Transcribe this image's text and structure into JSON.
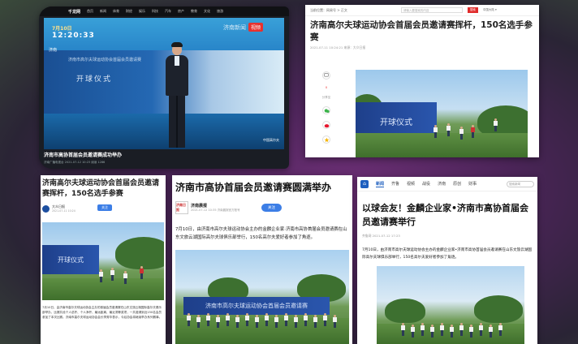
{
  "card1": {
    "topbar_brand": "千龙网",
    "topbar_items": [
      "首页",
      "新闻",
      "体育",
      "财经",
      "娱乐",
      "科技",
      "汽车",
      "房产",
      "教育",
      "文化",
      "旅游"
    ],
    "clock_date": "7月10日",
    "clock_time": "12:20:33",
    "channel": "济南",
    "watermark": "济南新闻",
    "watermark_badge": "视频",
    "backdrop_title": "开球仪式",
    "backdrop_sub": "济南市高尔夫球运动协会首届会员邀请赛",
    "corner_logo": "中国高尔夫",
    "caption": "济南市高协首届会员邀请赛成功举办",
    "meta": "济南广播电视台  2021-07-12 10:23  阅读 1286"
  },
  "card2": {
    "crumb": "当前位置：网易号 > 正文",
    "search_placeholder": "请输入要搜索的内容",
    "search_btn": "搜索",
    "right_link": "中国大陆 ▾",
    "title": "济南高尔夫球运动协会首届会员邀请赛挥杆，150名选手参赛",
    "meta": "2021-07-11 10:24:21   来源：大众日报",
    "rail_counts": [
      "0"
    ],
    "rail_label": "分享至",
    "photo_banner": "开球仪式"
  },
  "card3": {
    "title": "济南高尔夫球运动协会首届会员邀请赛挥杆，150名选手参赛",
    "author": "大众日报",
    "time": "2021-07-11 10:24",
    "follow": "关注",
    "photo_banner": "开球仪式",
    "body": "7月10日，由济南市高尔夫球运动协会主办的首届会员邀请赛在山东文旅云湖国际高尔夫俱乐部举办，比赛共设个人总杆、个人净杆、最远距离、最近洞等奖项，一共邀请到近150名会员参加了本次比赛。济南市高尔夫球运动协会会长李秀华表示，今后协会将继续举办系列赛事。"
  },
  "card4": {
    "title": "济南市高协首届会员邀请赛圆满举办",
    "author_logo": "济南日报",
    "author": "济南晨报",
    "time": "2021-07-12 10:35   济南晨报官方账号",
    "follow": "关注",
    "body": "7月10日，由济南市高尔夫球运动协会主办的金麟企业家·济南市高协首届会员邀请赛在山东文旅云湖国际高尔夫球俱乐部举行，150名高尔夫爱好者参加了角逐。",
    "photo_banner": "济南市高尔夫球运动协会首届会员邀请赛"
  },
  "card5": {
    "nav": [
      "新闻",
      "齐鲁",
      "视频",
      "战役",
      "济南",
      "原创",
      "财事"
    ],
    "search_placeholder": "搜索新闻",
    "title": "以球会友！金麟企业家•济南市高协首届会员邀请赛举行",
    "meta": "齐鲁网  2021-07-12 17:23",
    "body": "7月10日，由济南市高尔夫球运动协会主办的金麟企业家•济南市高协首届会员邀请赛在山东文旅云湖国际高尔夫球俱乐部举行，150名高尔夫爱好者参加了角逐。"
  }
}
